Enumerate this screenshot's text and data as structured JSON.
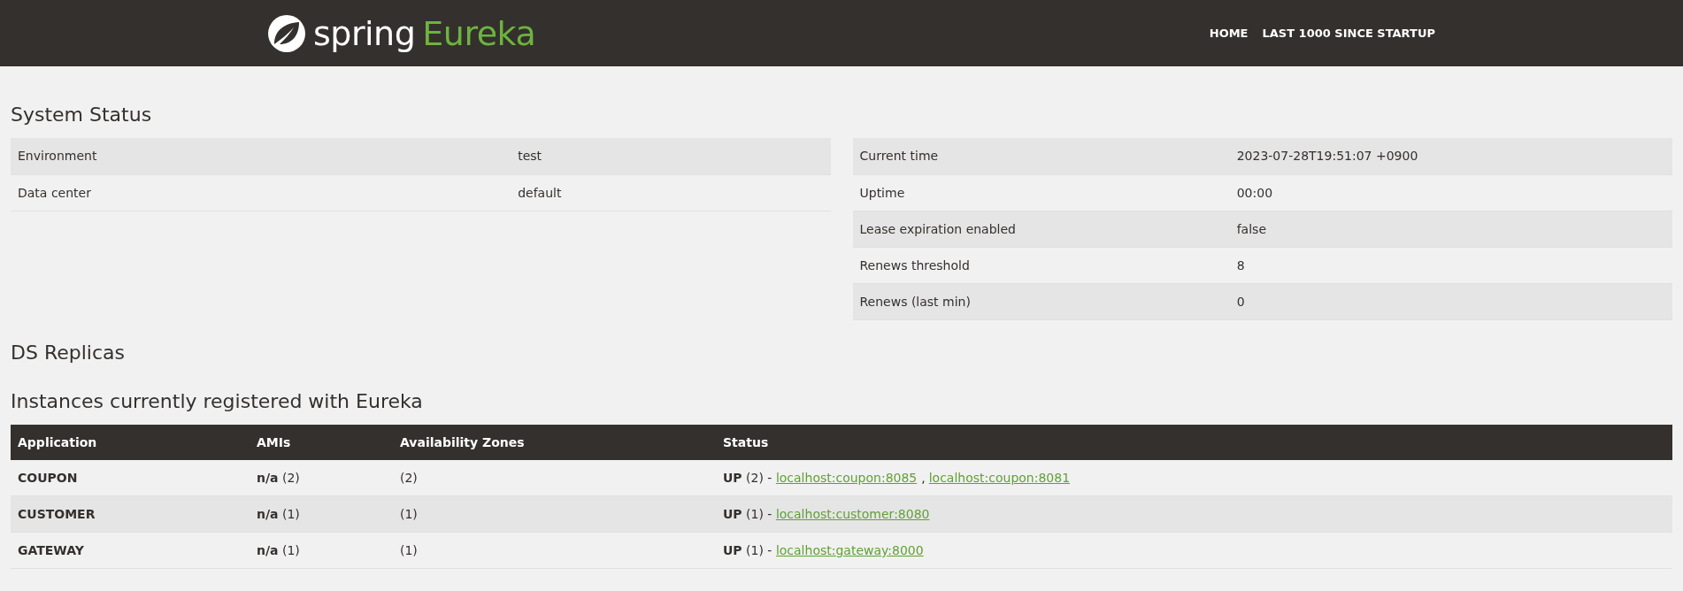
{
  "header": {
    "logo": {
      "brand": "spring",
      "product": "Eureka"
    },
    "nav": [
      "HOME",
      "LAST 1000 SINCE STARTUP"
    ]
  },
  "system_status": {
    "title": "System Status",
    "left": [
      {
        "label": "Environment",
        "value": "test"
      },
      {
        "label": "Data center",
        "value": "default"
      }
    ],
    "right": [
      {
        "label": "Current time",
        "value": "2023-07-28T19:51:07 +0900"
      },
      {
        "label": "Uptime",
        "value": "00:00"
      },
      {
        "label": "Lease expiration enabled",
        "value": "false"
      },
      {
        "label": "Renews threshold",
        "value": "8"
      },
      {
        "label": "Renews (last min)",
        "value": "0"
      }
    ]
  },
  "ds_replicas": {
    "title": "DS Replicas"
  },
  "instances": {
    "title": "Instances currently registered with Eureka",
    "link_separator": ",",
    "columns": [
      "Application",
      "AMIs",
      "Availability Zones",
      "Status"
    ],
    "rows": [
      {
        "application": "COUPON",
        "amis": "**n/a** (2)",
        "zones": "(2)",
        "status": "**UP** (2) -",
        "links": [
          "localhost:coupon:8085",
          "localhost:coupon:8081"
        ]
      },
      {
        "application": "CUSTOMER",
        "amis": "**n/a** (1)",
        "zones": "(1)",
        "status": "**UP** (1) -",
        "links": [
          "localhost:customer:8080"
        ]
      },
      {
        "application": "GATEWAY",
        "amis": "**n/a** (1)",
        "zones": "(1)",
        "status": "**UP** (1) -",
        "links": [
          "localhost:gateway:8000"
        ]
      }
    ]
  }
}
